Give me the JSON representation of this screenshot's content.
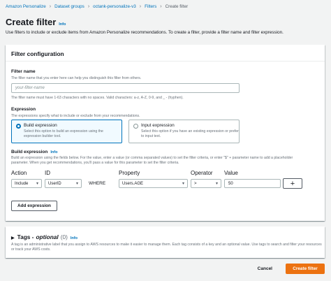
{
  "breadcrumbs": [
    {
      "label": "Amazon Personalize"
    },
    {
      "label": "Dataset groups"
    },
    {
      "label": "octank-personalize-v3"
    },
    {
      "label": "Filters"
    },
    {
      "label": "Create filter"
    }
  ],
  "page": {
    "title": "Create filter",
    "info": "Info",
    "subtitle": "Use filters to include or exclude items from Amazon Personalize recommendations. To create a filter, provide a filter name and filter expression."
  },
  "config": {
    "heading": "Filter configuration",
    "name_label": "Filter name",
    "name_desc": "The filter name that you enter here can help you distinguish this filter from others.",
    "name_placeholder": "your-filter-name",
    "name_constraint": "The filter name must have 1-63 characters with no spaces. Valid characters: a-z, A-Z, 0-9, and _ - (hyphen).",
    "expr_label": "Expression",
    "expr_desc": "The expressions specify what to include or exclude from your recommendations.",
    "options": [
      {
        "title": "Build expression",
        "desc": "Select this option to build an expression using the expression builder tool.",
        "selected": true
      },
      {
        "title": "Input expression",
        "desc": "Select this option if you have an existing expression or prefer to input text.",
        "selected": false
      }
    ],
    "builder_label": "Build expression",
    "builder_info": "Info",
    "builder_desc_1": "Build an expression using the fields below. For the value, enter a value (or comma separated values) to set the filter criteria, or enter \"$\" + parameter name to add a placeholder",
    "builder_desc_2": "parameter. When you get recommendations, you'll pass a value for this parameter to set the filter criteria.",
    "columns": {
      "action": "Action",
      "id": "ID",
      "property": "Property",
      "operator": "Operator",
      "value": "Value"
    },
    "row": {
      "action": "Include",
      "id": "UserID",
      "where": "WHERE",
      "property": "Users.AGE",
      "operator": ">",
      "value": "50"
    },
    "plus": "+",
    "add_expression": "Add expression"
  },
  "tags": {
    "caret": "▶",
    "title": "Tags -",
    "optional": "optional",
    "count": "(0)",
    "info": "Info",
    "desc": "A tag is an administrative label that you assign to AWS resources to make it easier to manage them. Each tag consists of a key and an optional value. Use tags to search and filter your resources or track your AWS costs."
  },
  "footer": {
    "cancel": "Cancel",
    "create": "Create filter"
  },
  "colors": {
    "link": "#0073bb",
    "primary": "#ec7211",
    "background": "#f2f3f3"
  },
  "icons": {
    "breadcrumb_separator": "chevron-right-icon",
    "select_caret": "chevron-down-icon",
    "add_condition": "plus-icon",
    "expand": "caret-right-icon"
  }
}
